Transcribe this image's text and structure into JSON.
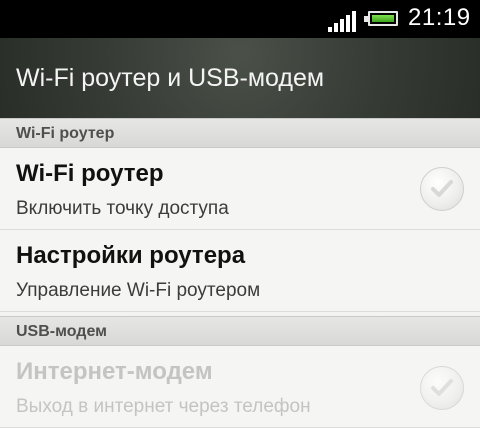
{
  "status_bar": {
    "time": "21:19",
    "signal_icon": "signal-bars-icon",
    "battery_icon": "battery-icon",
    "battery_color": "#5ccc34"
  },
  "title_bar": {
    "title": "Wi-Fi роутер и USB-модем"
  },
  "sections": [
    {
      "header": "Wi-Fi роутер",
      "items": [
        {
          "title": "Wi-Fi роутер",
          "subtitle": "Включить точку доступа",
          "checkbox": true,
          "checked": false,
          "enabled": true
        },
        {
          "title": "Настройки роутера",
          "subtitle": "Управление Wi-Fi роутером",
          "checkbox": false,
          "enabled": true
        }
      ]
    },
    {
      "header": "USB-модем",
      "items": [
        {
          "title": "Интернет-модем",
          "subtitle": "Выход в интернет через телефон",
          "checkbox": true,
          "checked": false,
          "enabled": false
        }
      ]
    }
  ]
}
